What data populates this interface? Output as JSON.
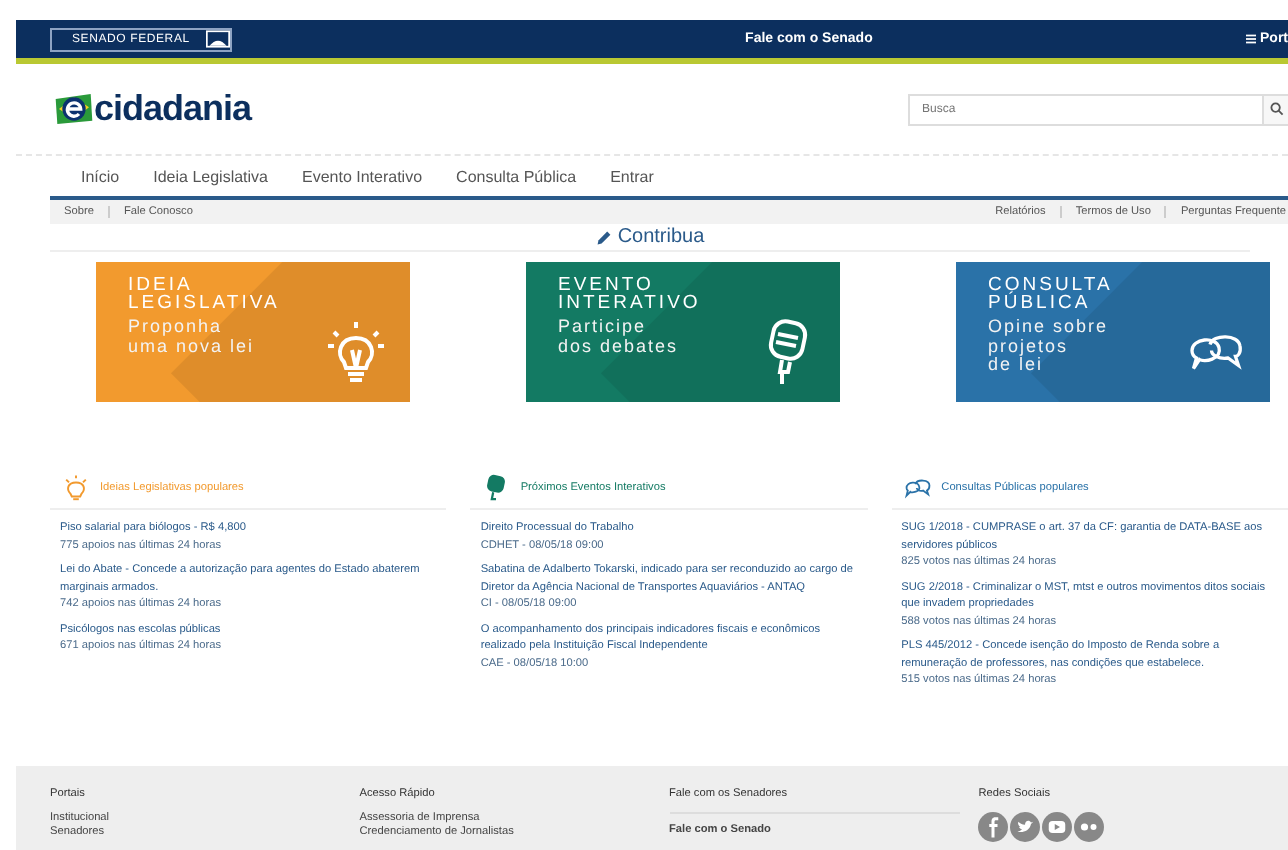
{
  "top_bar": {
    "brand": "SENADO FEDERAL",
    "center_link": "Fale com o Senado",
    "menu_label": "Port"
  },
  "logo": {
    "text": "cidadania"
  },
  "search": {
    "placeholder": "Busca"
  },
  "nav": [
    "Início",
    "Ideia Legislativa",
    "Evento Interativo",
    "Consulta Pública",
    "Entrar"
  ],
  "subnav_left": [
    "Sobre",
    "Fale Conosco"
  ],
  "subnav_right": [
    "Relatórios",
    "Termos de Uso",
    "Perguntas Frequente"
  ],
  "contribua": "Contribua",
  "cards": [
    {
      "kind": "idea",
      "title_lines": [
        "IDEIA",
        "LEGISLATIVA"
      ],
      "sub_lines": [
        "Proponha",
        "uma nova lei"
      ],
      "color": "#f29a2e"
    },
    {
      "kind": "event",
      "title_lines": [
        "EVENTO",
        "INTERATIVO"
      ],
      "sub_lines": [
        "Participe",
        "dos debates"
      ],
      "color": "#137a63"
    },
    {
      "kind": "consult",
      "title_lines": [
        "CONSULTA",
        "PÚBLICA"
      ],
      "sub_lines": [
        "Opine sobre",
        "projetos",
        "de lei"
      ],
      "color": "#2a72a8"
    }
  ],
  "sections": [
    {
      "kind": "idea",
      "title": "Ideias Legislativas populares",
      "color": "#f29a2e",
      "items": [
        {
          "title": "Piso salarial para biólogos - R$ 4,800",
          "meta": "775 apoios nas últimas 24 horas"
        },
        {
          "title": "Lei do Abate - Concede a autorização para agentes do Estado abaterem marginais armados.",
          "meta": "742 apoios nas últimas 24 horas"
        },
        {
          "title": "Psicólogos nas escolas públicas",
          "meta": "671 apoios nas últimas 24 horas"
        }
      ]
    },
    {
      "kind": "event",
      "title": "Próximos Eventos Interativos",
      "color": "#137a63",
      "items": [
        {
          "title": "Direito Processual do Trabalho",
          "meta": "CDHET - 08/05/18 09:00"
        },
        {
          "title": "Sabatina de Adalberto Tokarski, indicado para ser reconduzido ao cargo de Diretor da Agência Nacional de Transportes Aquaviários - ANTAQ",
          "meta": "CI - 08/05/18 09:00"
        },
        {
          "title": "O acompanhamento dos principais indicadores fiscais e econômicos realizado pela Instituição Fiscal Independente",
          "meta": "CAE - 08/05/18 10:00"
        }
      ]
    },
    {
      "kind": "consult",
      "title": "Consultas Públicas populares",
      "color": "#2a72a8",
      "items": [
        {
          "title": "SUG 1/2018 - CUMPRASE o art. 37 da CF: garantia de DATA-BASE aos servidores públicos",
          "meta": "825 votos nas últimas 24 horas"
        },
        {
          "title": "SUG 2/2018 - Criminalizar o MST, mtst e outros movimentos ditos sociais que invadem propriedades",
          "meta": "588 votos nas últimas 24 horas"
        },
        {
          "title": "PLS 445/2012 - Concede isenção do Imposto de Renda sobre a remuneração de professores, nas condições que estabelece.",
          "meta": "515 votos nas últimas 24 horas"
        }
      ]
    }
  ],
  "footer": [
    {
      "kind": "links",
      "heading": "Portais",
      "links": [
        "Institucional",
        "Senadores"
      ]
    },
    {
      "kind": "links",
      "heading": "Acesso Rápido",
      "links": [
        "Assessoria de Imprensa",
        "Credenciamento de Jornalistas"
      ]
    },
    {
      "kind": "contact",
      "heading": "Fale com os Senadores",
      "links": [
        "Fale com o Senado"
      ]
    },
    {
      "kind": "social",
      "heading": "Redes Sociais",
      "icons": [
        {
          "kind": "facebook"
        },
        {
          "kind": "twitter"
        },
        {
          "kind": "youtube"
        },
        {
          "kind": "flickr"
        }
      ]
    }
  ]
}
